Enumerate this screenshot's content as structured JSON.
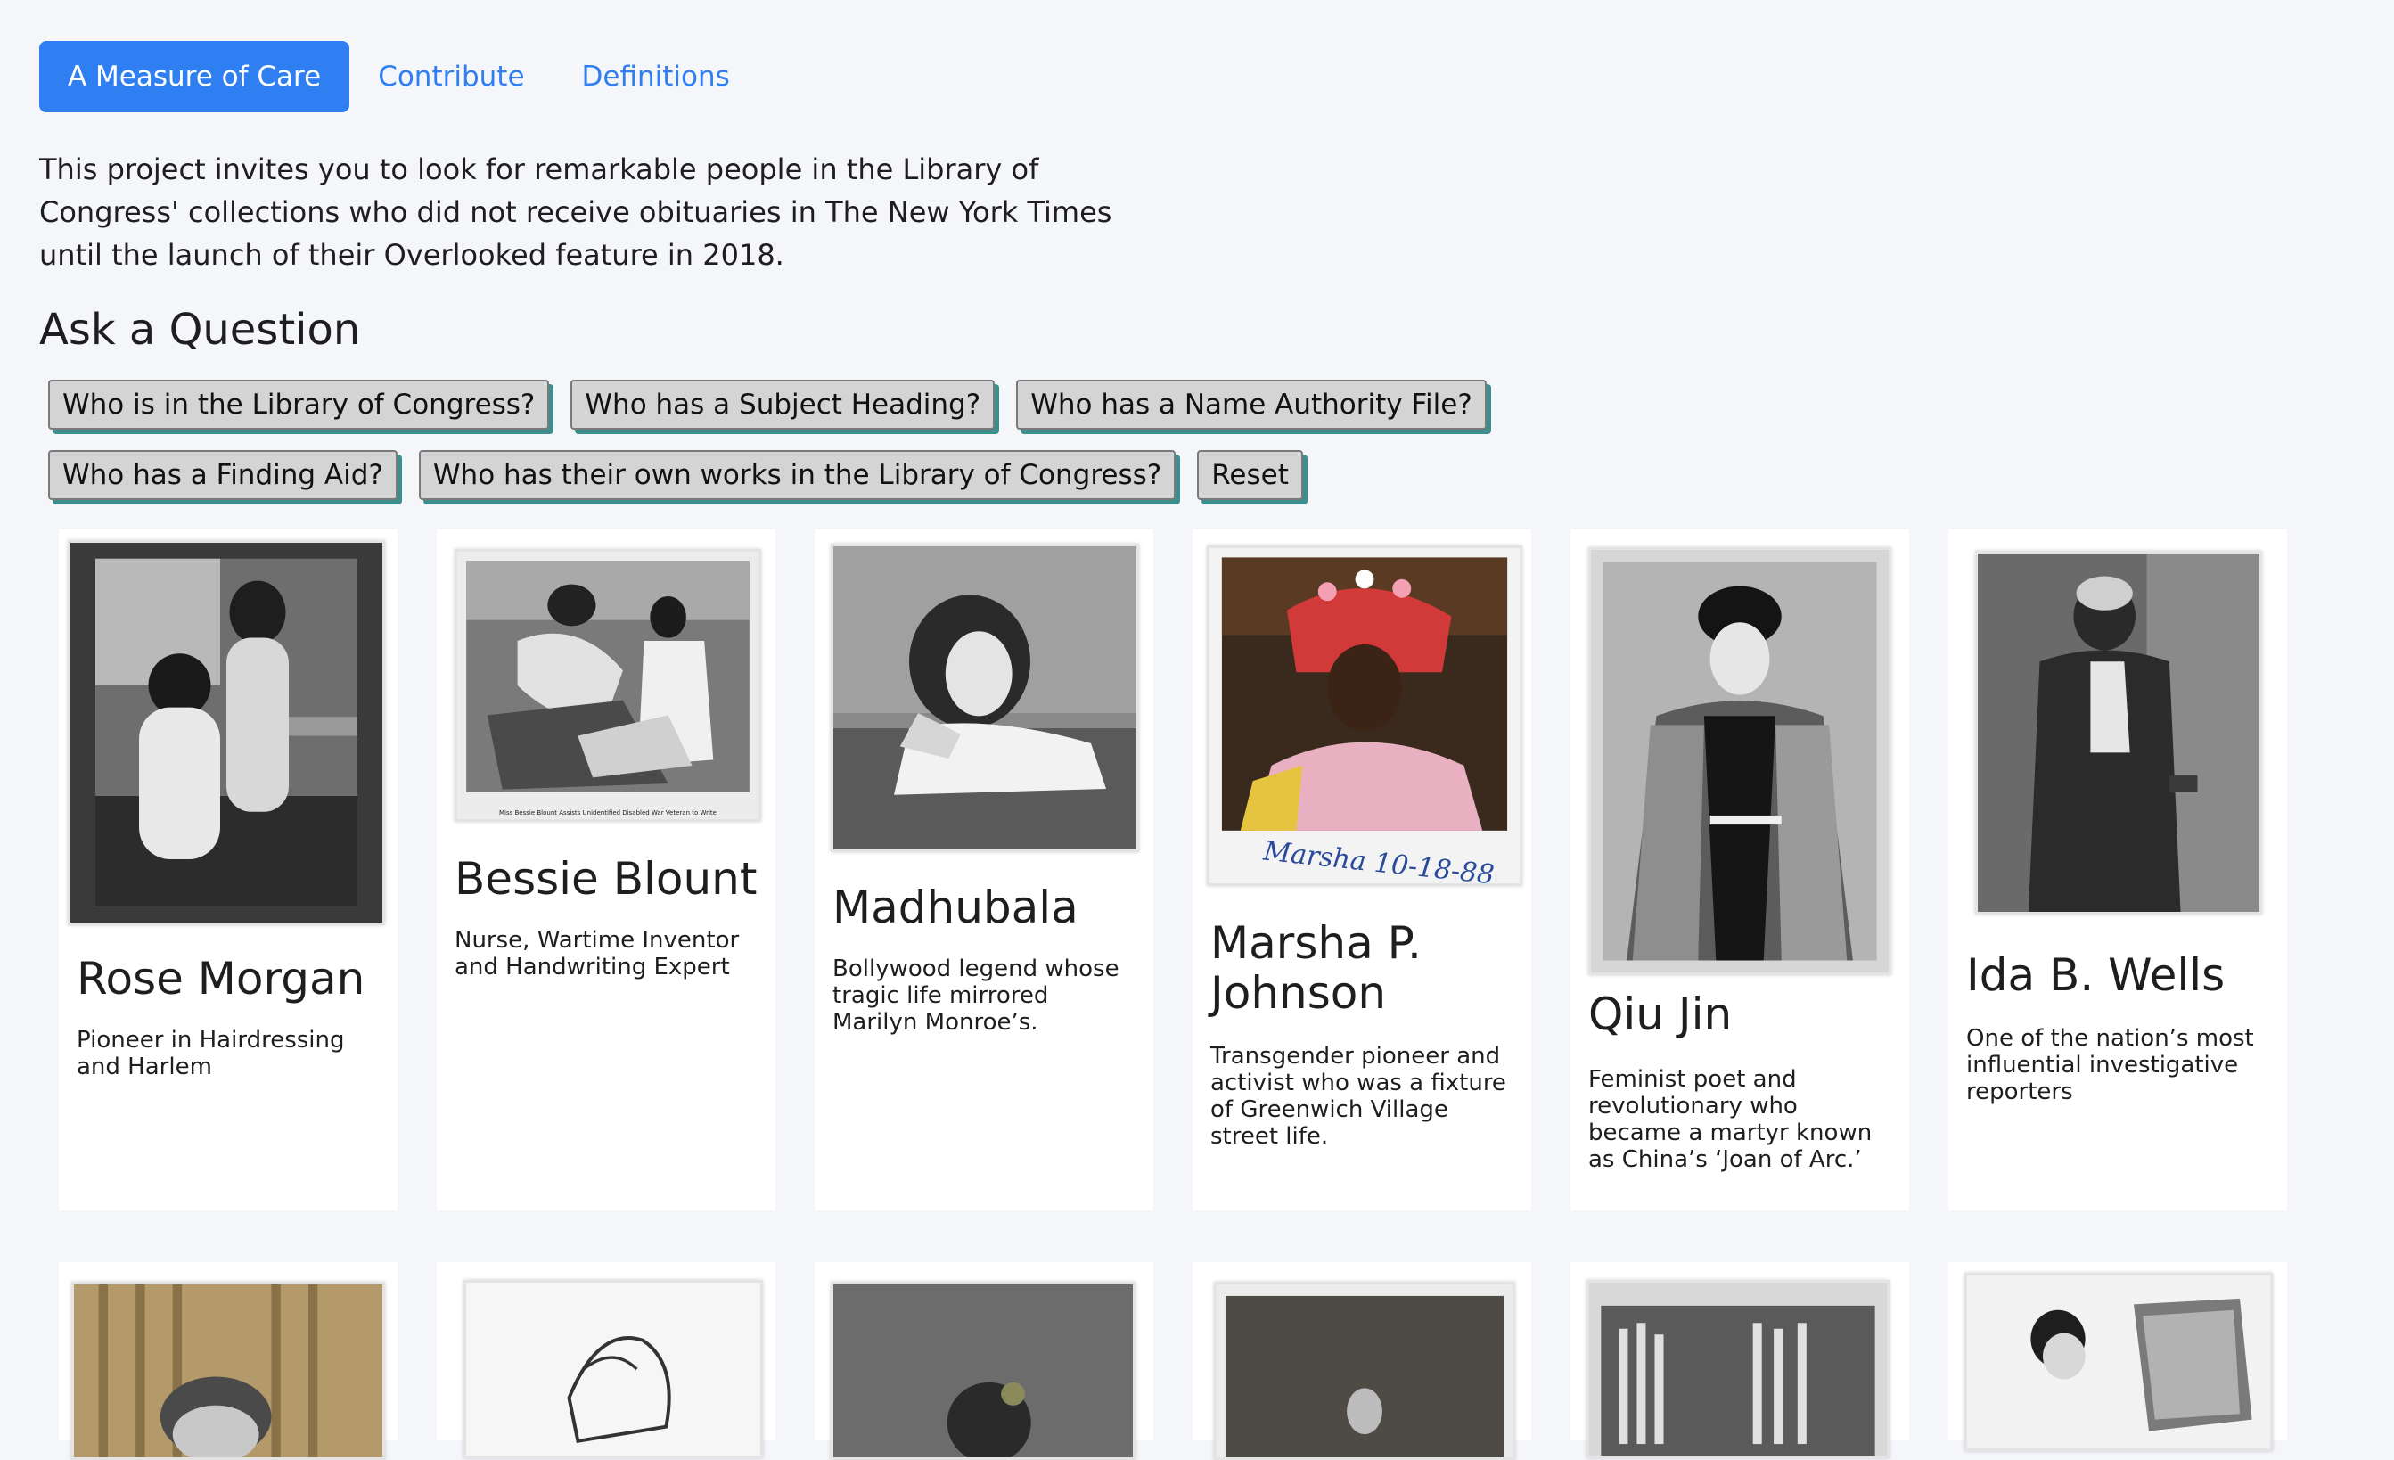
{
  "nav": {
    "items": [
      {
        "label": "A Measure of Care"
      },
      {
        "label": "Contribute"
      },
      {
        "label": "Definitions"
      }
    ]
  },
  "intro": {
    "text": "This project invites you to look for remarkable people in the Library of Congress' collections who did not receive obituaries in The New York Times until the launch of their Overlooked feature in 2018."
  },
  "ask": {
    "title": "Ask a Question",
    "buttons": [
      {
        "label": "Who is in the Library of Congress?"
      },
      {
        "label": "Who has a Subject Heading?"
      },
      {
        "label": "Who has a Name Authority File?"
      },
      {
        "label": "Who has a Finding Aid?"
      },
      {
        "label": "Who has their own works in the Library of Congress?"
      },
      {
        "label": "Reset"
      }
    ]
  },
  "cards": [
    {
      "name": "Rose Morgan",
      "description": "Pioneer in Hairdressing and Harlem"
    },
    {
      "name": "Bessie Blount",
      "description": "Nurse, Wartime Inventor and Handwriting Expert",
      "photo_caption": "Miss Bessie Blount Assists Unidentified Disabled War Veteran to Write"
    },
    {
      "name": "Madhubala",
      "description": "Bollywood legend whose tragic life mirrored Marilyn Monroe’s."
    },
    {
      "name": "Marsha P. Johnson",
      "description": "Transgender pioneer and activist who was a fixture of Greenwich Village street life.",
      "photo_caption": "Marsha 10-18-88"
    },
    {
      "name": "Qiu Jin",
      "description": "Feminist poet and revolutionary who became a martyr known as China’s ‘Joan of Arc.’"
    },
    {
      "name": "Ida B. Wells",
      "description": "One of the nation’s most influential investigative reporters"
    }
  ],
  "colors": {
    "accent": "#2f7ff2",
    "background": "#f5f6fa",
    "button_shadow": "#3c8f8c",
    "button_bg": "#d4d4d4"
  }
}
